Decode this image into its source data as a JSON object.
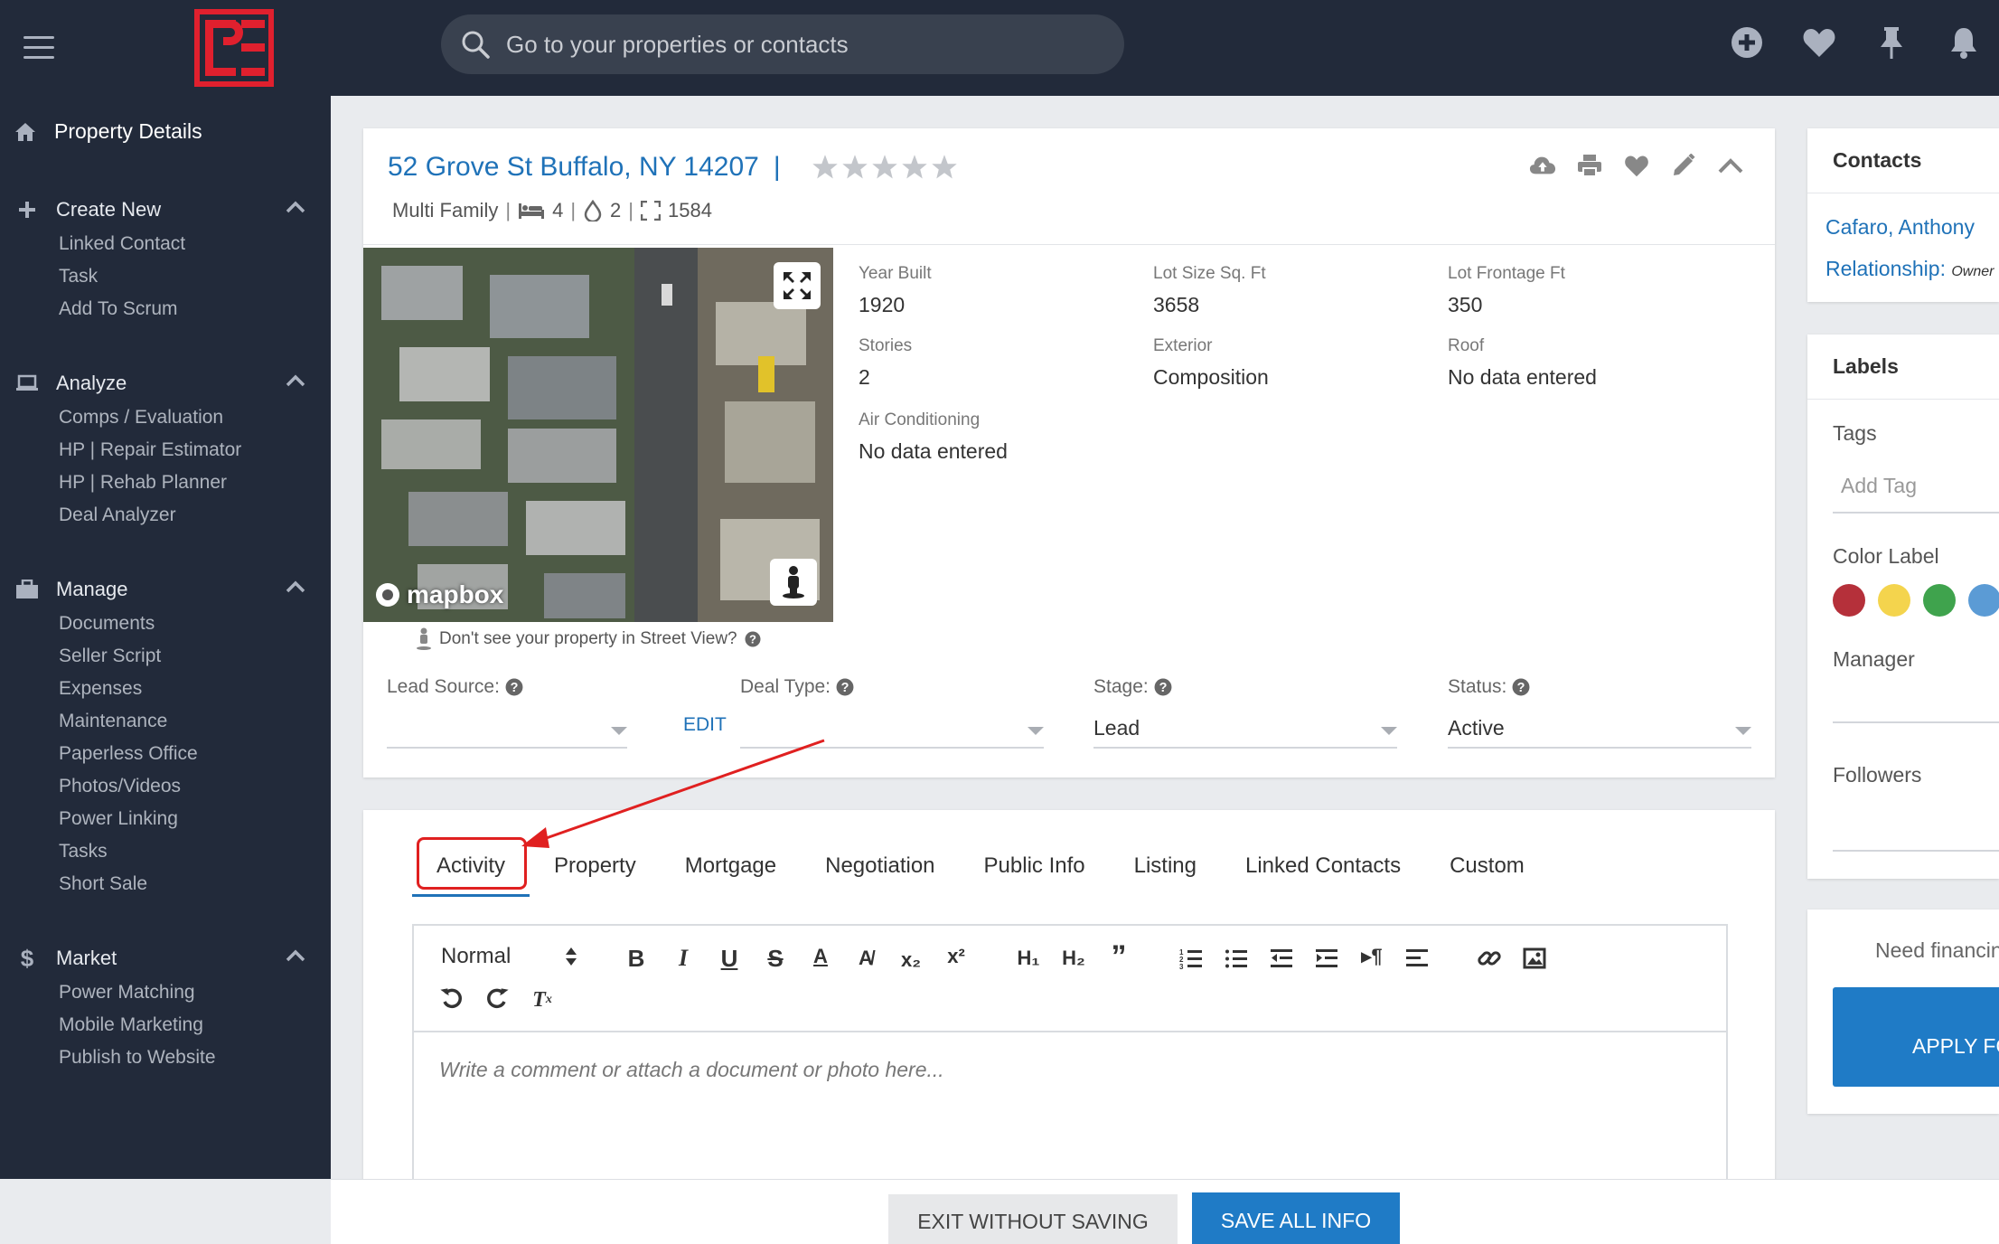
{
  "topbar": {
    "search_placeholder": "Go to your properties or contacts",
    "icons": [
      "plus-circle-icon",
      "heart-icon",
      "pin-icon",
      "bell-icon"
    ]
  },
  "sidebar": {
    "top_item": "Property Details",
    "sections": [
      {
        "title": "Create New",
        "icon": "plus-icon",
        "items": [
          "Linked Contact",
          "Task",
          "Add To Scrum"
        ]
      },
      {
        "title": "Analyze",
        "icon": "laptop-icon",
        "items": [
          "Comps / Evaluation",
          "HP | Repair Estimator",
          "HP | Rehab Planner",
          "Deal Analyzer"
        ]
      },
      {
        "title": "Manage",
        "icon": "briefcase-icon",
        "items": [
          "Documents",
          "Seller Script",
          "Expenses",
          "Maintenance",
          "Paperless Office",
          "Photos/Videos",
          "Power Linking",
          "Tasks",
          "Short Sale"
        ]
      },
      {
        "title": "Market",
        "icon": "dollar-icon",
        "items": [
          "Power Matching",
          "Mobile Marketing",
          "Publish to Website"
        ]
      }
    ]
  },
  "property": {
    "address": "52 Grove St Buffalo, NY 14207",
    "separator": "|",
    "rating": 0,
    "type": "Multi Family",
    "beds": "4",
    "baths": "2",
    "sqft": "1584",
    "mapbox": "mapbox",
    "street_view_question": "Don't see your property in Street View?",
    "facts": [
      {
        "label": "Year Built",
        "value": "1920"
      },
      {
        "label": "Lot Size Sq. Ft",
        "value": "3658"
      },
      {
        "label": "Lot Frontage Ft",
        "value": "350"
      },
      {
        "label": "Stories",
        "value": "2"
      },
      {
        "label": "Exterior",
        "value": "Composition"
      },
      {
        "label": "Roof",
        "value": "No data entered"
      },
      {
        "label": "Air Conditioning",
        "value": "No data entered"
      }
    ],
    "selects": {
      "lead_source": {
        "label": "Lead Source:",
        "value": ""
      },
      "edit": "EDIT",
      "deal_type": {
        "label": "Deal Type:",
        "value": ""
      },
      "stage": {
        "label": "Stage:",
        "value": "Lead"
      },
      "status": {
        "label": "Status:",
        "value": "Active"
      }
    }
  },
  "tabs": [
    "Activity",
    "Property",
    "Mortgage",
    "Negotiation",
    "Public Info",
    "Listing",
    "Linked Contacts",
    "Custom"
  ],
  "active_tab": "Activity",
  "editor": {
    "format": "Normal",
    "placeholder": "Write a comment or attach a document or photo here..."
  },
  "buttons": {
    "exit": "EXIT WITHOUT SAVING",
    "save": "SAVE ALL INFO"
  },
  "contacts": {
    "title": "Contacts",
    "name": "Cafaro, Anthony",
    "relationship_label": "Relationship:",
    "relationship_value": "Owner"
  },
  "labels": {
    "title": "Labels",
    "tags": "Tags",
    "add_tag": "Add Tag",
    "color_label": "Color Label",
    "colors": [
      "#b5303a",
      "#f4d44d",
      "#3fa34d",
      "#5b9bd5"
    ],
    "manager": "Manager",
    "followers": "Followers"
  },
  "financing": {
    "text": "Need financing?",
    "button": "APPLY FOR FUNDING"
  },
  "colors": {
    "accent": "#1f72b8",
    "annotation": "#e02020",
    "sidebar": "#222a3a",
    "brand": "#e0202e"
  }
}
